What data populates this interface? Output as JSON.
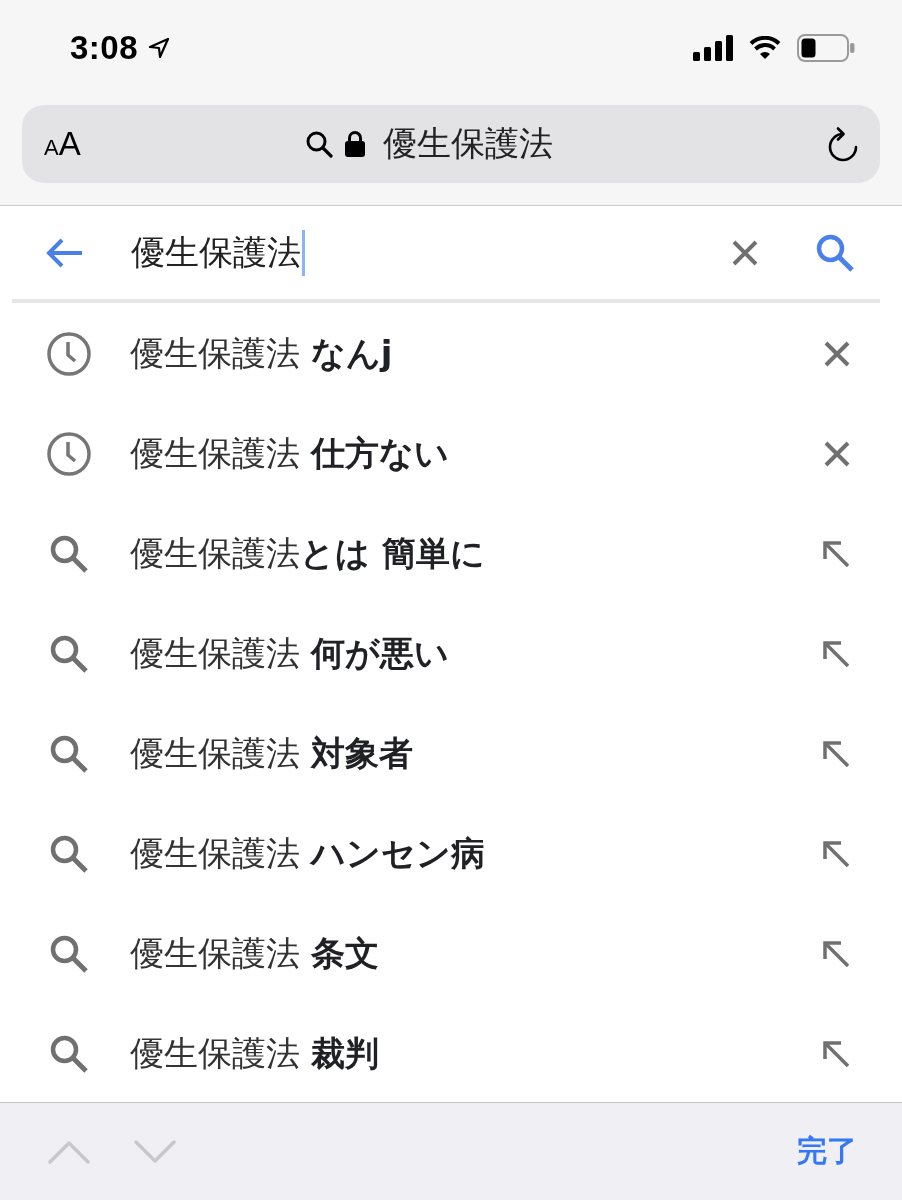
{
  "status_bar": {
    "time": "3:08"
  },
  "address_bar": {
    "text_size_button": "AA",
    "url": "優生保護法"
  },
  "search": {
    "value": "優生保護法"
  },
  "suggestions": [
    {
      "kind": "history",
      "text": "優生保護法 **なんj**"
    },
    {
      "kind": "history",
      "text": "優生保護法 **仕方ない**"
    },
    {
      "kind": "search",
      "text": "優生保護法**とは 簡単に**"
    },
    {
      "kind": "search",
      "text": "優生保護法 **何が悪い**"
    },
    {
      "kind": "search",
      "text": "優生保護法 **対象者**"
    },
    {
      "kind": "search",
      "text": "優生保護法 **ハンセン病**"
    },
    {
      "kind": "search",
      "text": "優生保護法 **条文**"
    },
    {
      "kind": "search",
      "text": "優生保護法 **裁判**"
    }
  ],
  "toolbar": {
    "previous": {
      "disabled": true
    },
    "next": {
      "disabled": true
    },
    "done_button": "完了"
  }
}
